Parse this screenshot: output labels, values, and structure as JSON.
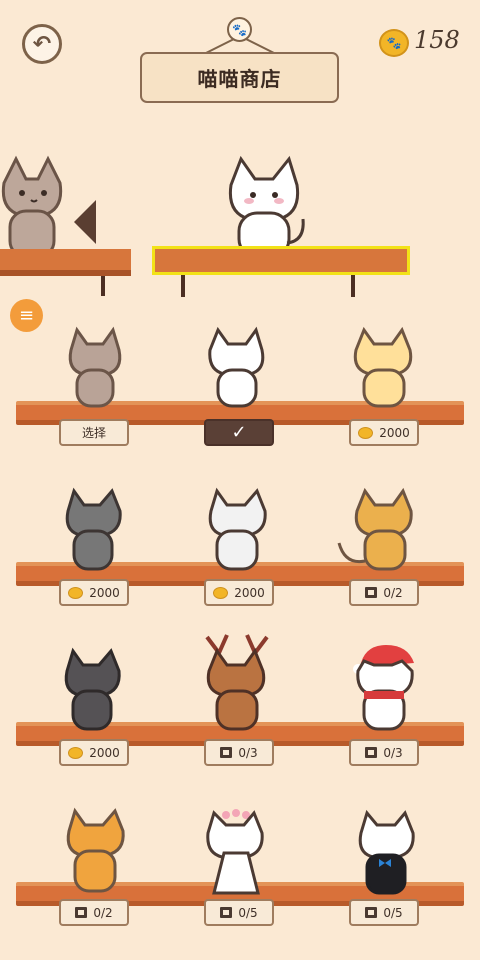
{
  "header": {
    "back_label": "↶",
    "title": "喵喵商店",
    "coin_count": "158"
  },
  "shop": {
    "items": [
      {
        "label": "选择",
        "kind": "select"
      },
      {
        "label": "✓",
        "kind": "selected"
      },
      {
        "label": "2000",
        "kind": "coin"
      },
      {
        "label": "2000",
        "kind": "coin"
      },
      {
        "label": "2000",
        "kind": "coin"
      },
      {
        "label": "0/2",
        "kind": "video"
      },
      {
        "label": "2000",
        "kind": "coin"
      },
      {
        "label": "0/3",
        "kind": "video"
      },
      {
        "label": "0/3",
        "kind": "video"
      },
      {
        "label": "0/2",
        "kind": "video"
      },
      {
        "label": "0/5",
        "kind": "video"
      },
      {
        "label": "0/5",
        "kind": "video"
      }
    ]
  },
  "colors": {
    "background": "#fbe9d3",
    "shelf": "#d9713a",
    "highlight": "#f2e217",
    "coin": "#f2b527"
  }
}
